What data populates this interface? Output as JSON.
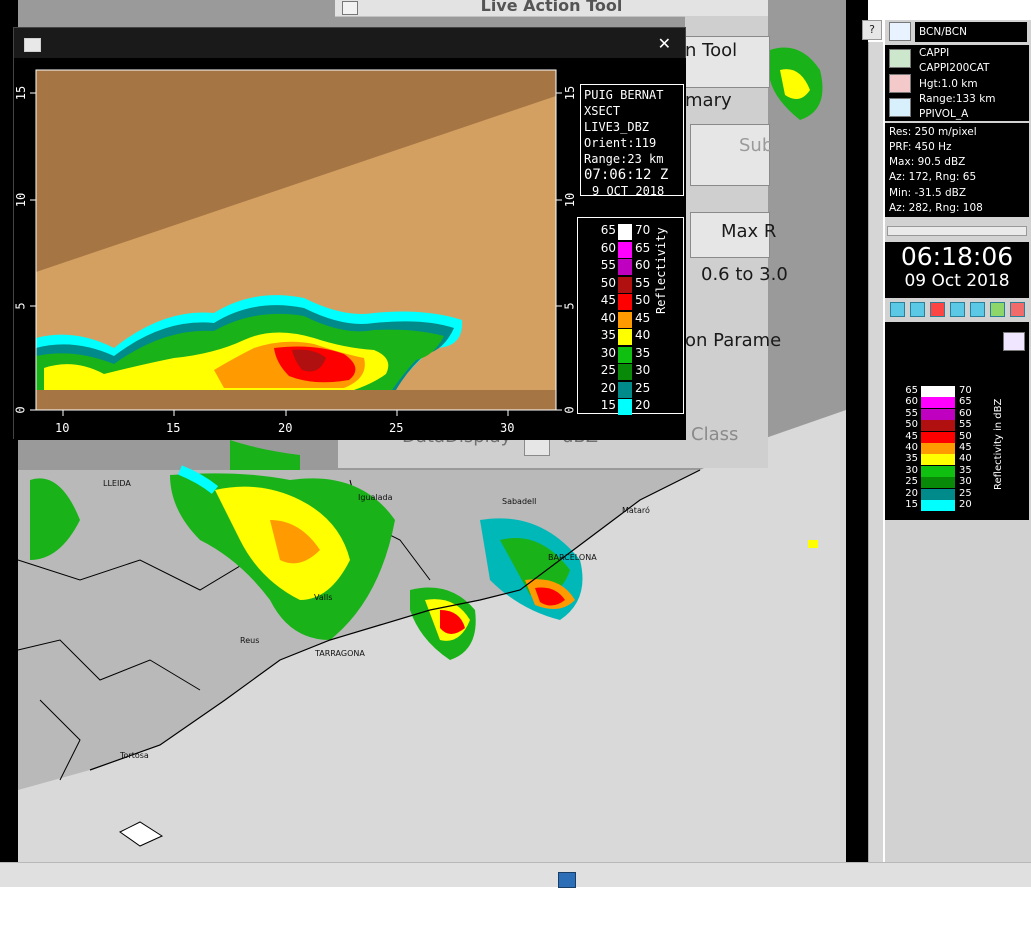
{
  "bg_window": {
    "title": "Live Action Tool",
    "labels": [
      "n Tool",
      "mary",
      "Sub",
      "Max R",
      "0.6 to 3.0",
      "on Parame",
      "Class",
      "DataDisplay",
      "dBZ"
    ]
  },
  "xsect": {
    "info_lines": [
      "PUIG BERNAT",
      "XSECT",
      "LIVE3_DBZ",
      "Orient:119",
      "Range:23 km",
      "07:06:12 Z",
      "9 OCT 2018"
    ],
    "y_ticks": [
      "15",
      "10",
      "5",
      "0"
    ],
    "x_ticks": [
      "10",
      "15",
      "20",
      "25",
      "30"
    ],
    "legend_title": "Reflectivity",
    "legend": [
      {
        "lo": "65",
        "hi": "70",
        "color": "#ffffff"
      },
      {
        "lo": "60",
        "hi": "65",
        "color": "#ff00ff"
      },
      {
        "lo": "55",
        "hi": "60",
        "color": "#c000c0"
      },
      {
        "lo": "50",
        "hi": "55",
        "color": "#b01010"
      },
      {
        "lo": "45",
        "hi": "50",
        "color": "#ff0000"
      },
      {
        "lo": "40",
        "hi": "45",
        "color": "#ff9a00"
      },
      {
        "lo": "35",
        "hi": "40",
        "color": "#ffff00"
      },
      {
        "lo": "30",
        "hi": "35",
        "color": "#10c010"
      },
      {
        "lo": "25",
        "hi": "30",
        "color": "#088a08"
      },
      {
        "lo": "20",
        "hi": "25",
        "color": "#008a8a"
      },
      {
        "lo": "15",
        "hi": "20",
        "color": "#00ffff"
      }
    ]
  },
  "map": {
    "cities": [
      "LLEIDA",
      "Igualada",
      "Sabadell",
      "Mataró",
      "BARCELONA",
      "Valls",
      "Reus",
      "TARRAGONA",
      "Tortosa"
    ]
  },
  "panel": {
    "help": "?",
    "station": "BCN/BCN",
    "product_lines": [
      "CAPPI",
      "CAPPI200CAT",
      "Hgt:1.0 km",
      "Range:133 km",
      "PPIVOL_A"
    ],
    "info_lines": [
      "Res: 250 m/pixel",
      "PRF: 450 Hz",
      "Max: 90.5 dBZ",
      "Az:  172, Rng: 65",
      "Min: -31.5 dBZ",
      "Az:  282, Rng: 108"
    ],
    "clock_time": "06:18:06",
    "clock_date": "09 Oct 2018",
    "legend_title": "Reflectivity in dBZ"
  },
  "icons": [
    "window-icon",
    "close-icon",
    "station-icon",
    "radar-product-icon",
    "heart-monitor-icon",
    "clock-icon",
    "play-back-icon",
    "play-icon",
    "stop-icon",
    "step-back-icon",
    "step-forward-icon",
    "loop-icon",
    "save-icon",
    "palette-icon",
    "taskbar-app-icon"
  ]
}
